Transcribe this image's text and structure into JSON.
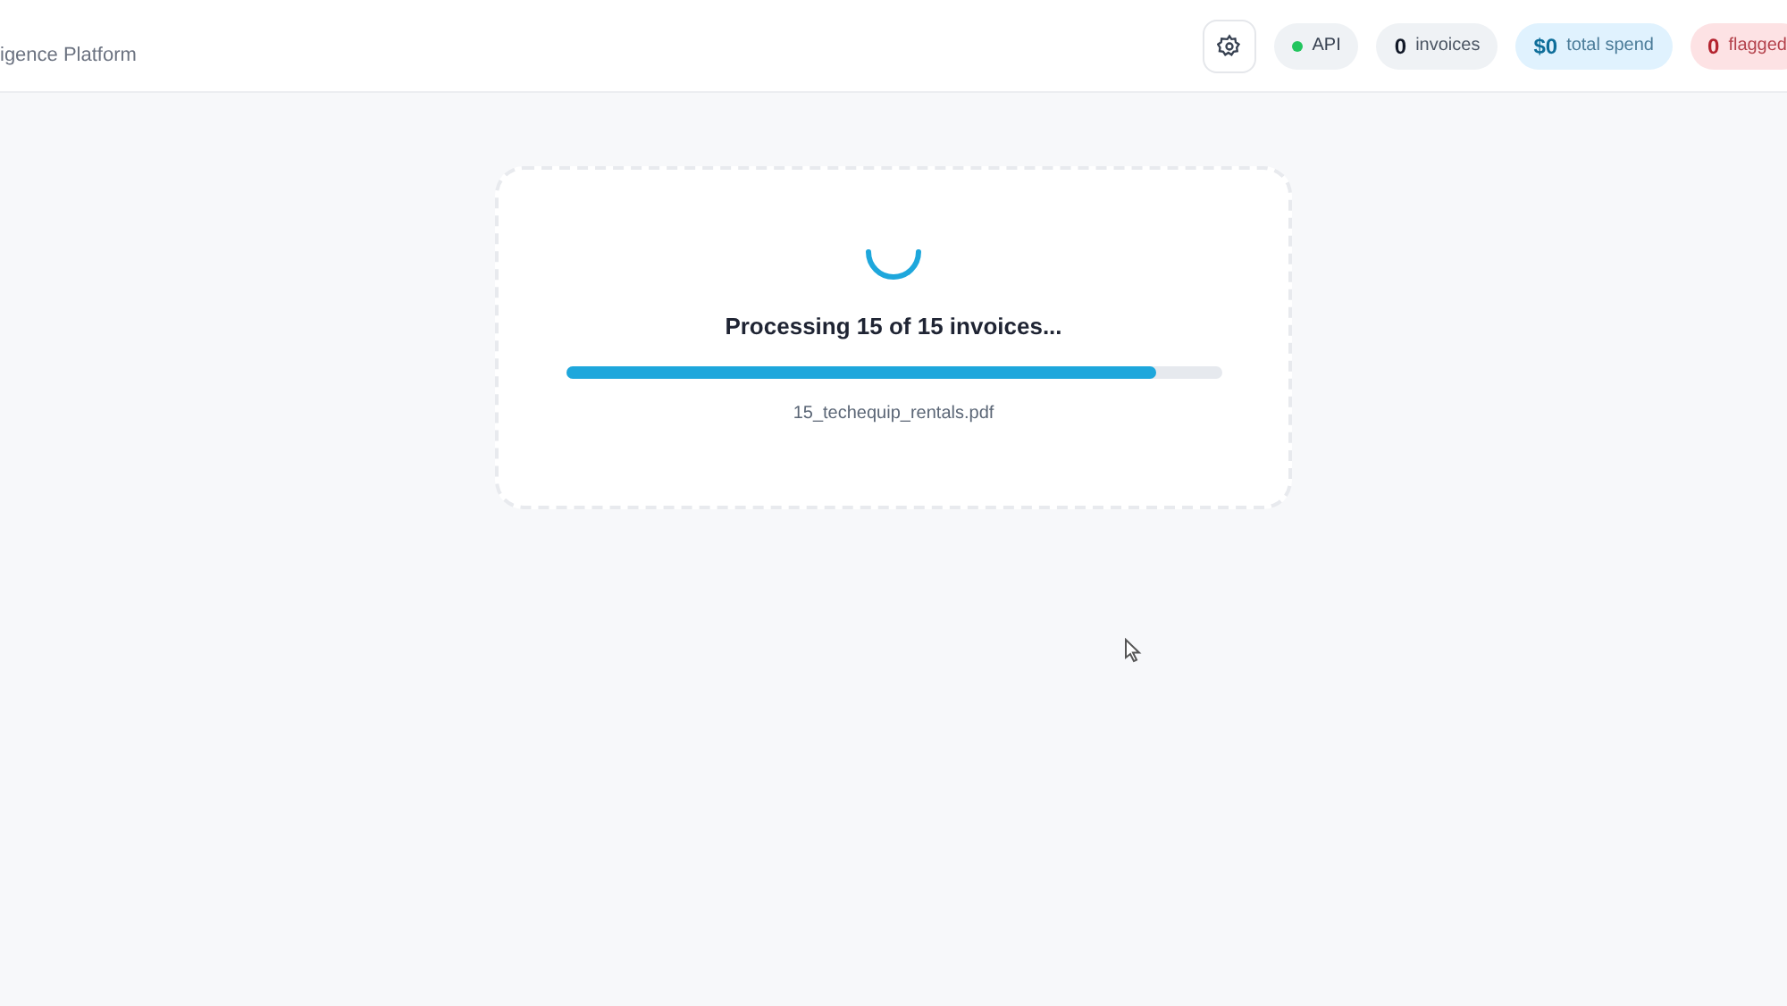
{
  "header": {
    "subtitle": "igence Platform",
    "badges": [
      {
        "kind": "status",
        "label": "API",
        "color": "#22c55e"
      },
      {
        "kind": "count",
        "value": "0",
        "label": "invoices"
      },
      {
        "kind": "spend",
        "value": "$0",
        "label": "total spend"
      },
      {
        "kind": "flagged",
        "value": "0",
        "label": "flagged"
      }
    ]
  },
  "processing": {
    "title": "Processing 15 of 15 invoices...",
    "level": 0.9,
    "file": "15_techequip_rentals.pdf"
  }
}
